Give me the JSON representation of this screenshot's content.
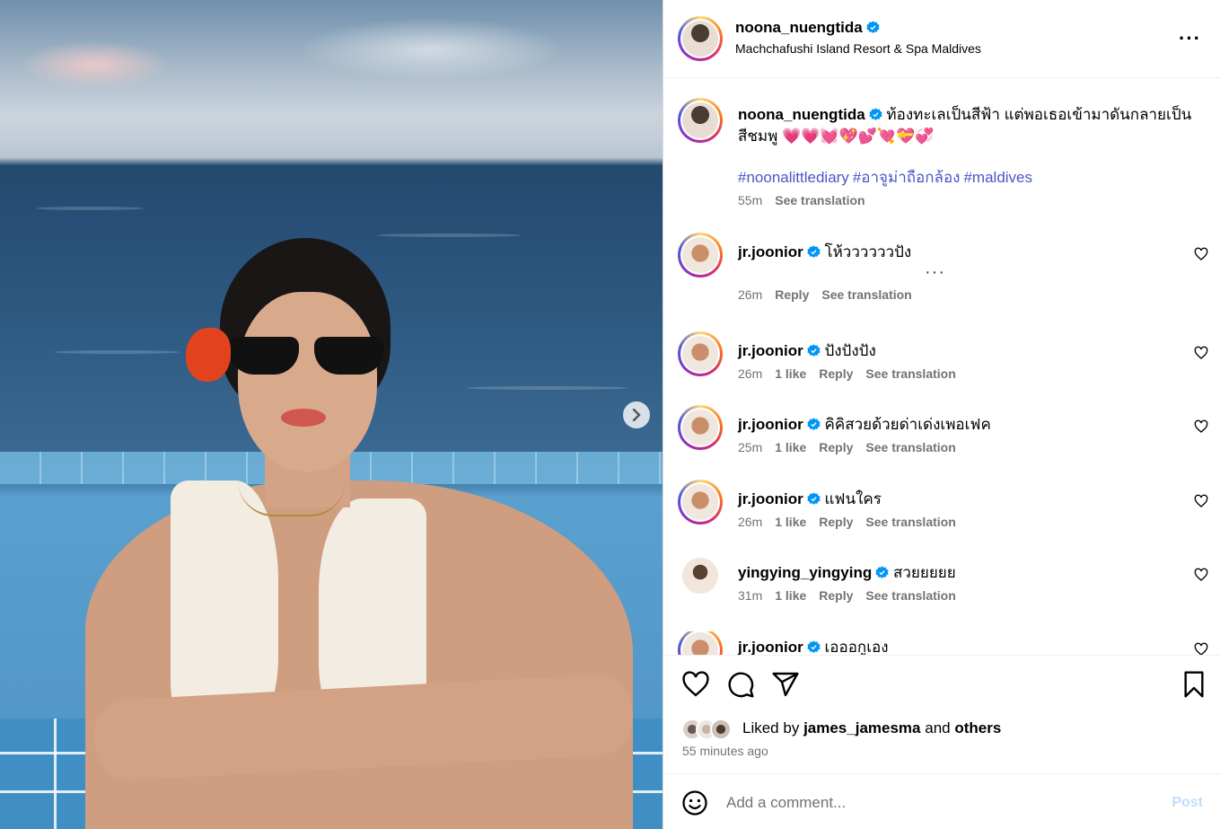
{
  "post": {
    "username": "noona_nuengtida",
    "location": "Machchafushi Island Resort & Spa Maldives",
    "caption": "ท้องทะเลเป็นสีฟ้า แต่พอเธอเข้ามาดันกลายเป็นสีชมพู 💗💗💓💖💕💘💝💞",
    "hashtags": [
      "#noonalittlediary",
      "#อาจูม่าถือกล้อง",
      "#maldives"
    ],
    "time": "55m",
    "see_translation": "See translation"
  },
  "comments": [
    {
      "username": "jr.joonior",
      "text": "โห้ววววววปัง",
      "time": "26m",
      "likes": "",
      "reply": "Reply",
      "translate": "See translation"
    },
    {
      "username": "jr.joonior",
      "text": "ปังปังปัง",
      "time": "26m",
      "likes": "1 like",
      "reply": "Reply",
      "translate": "See translation"
    },
    {
      "username": "jr.joonior",
      "text": "คิคิสวยด้วยด่าเด่งเพอเฟค",
      "time": "25m",
      "likes": "1 like",
      "reply": "Reply",
      "translate": "See translation"
    },
    {
      "username": "jr.joonior",
      "text": "แฟนใคร",
      "time": "26m",
      "likes": "1 like",
      "reply": "Reply",
      "translate": "See translation"
    },
    {
      "username": "yingying_yingying",
      "text": "สวยยยยย",
      "time": "31m",
      "likes": "1 like",
      "reply": "Reply",
      "translate": "See translation"
    },
    {
      "username": "jr.joonior",
      "text": "เอออกูเอง",
      "time": "",
      "likes": "",
      "reply": "",
      "translate": ""
    }
  ],
  "likes": {
    "prefix": "Liked by",
    "user": "james_jamesma",
    "and": "and",
    "others": "others",
    "time_ago": "55 minutes ago"
  },
  "composer": {
    "placeholder": "Add a comment...",
    "post_label": "Post"
  },
  "icons": {
    "more": "more-options-icon",
    "next": "chevron-right-icon",
    "like": "heart-icon",
    "comment": "comment-bubble-icon",
    "share": "paper-plane-icon",
    "save": "bookmark-icon",
    "emoji": "emoji-smile-icon",
    "verified": "verified-badge-icon"
  },
  "colors": {
    "link_blue": "#4a56c7",
    "verified_blue": "#0095f6",
    "post_disabled": "#c0dffd",
    "muted_text": "#737373"
  }
}
